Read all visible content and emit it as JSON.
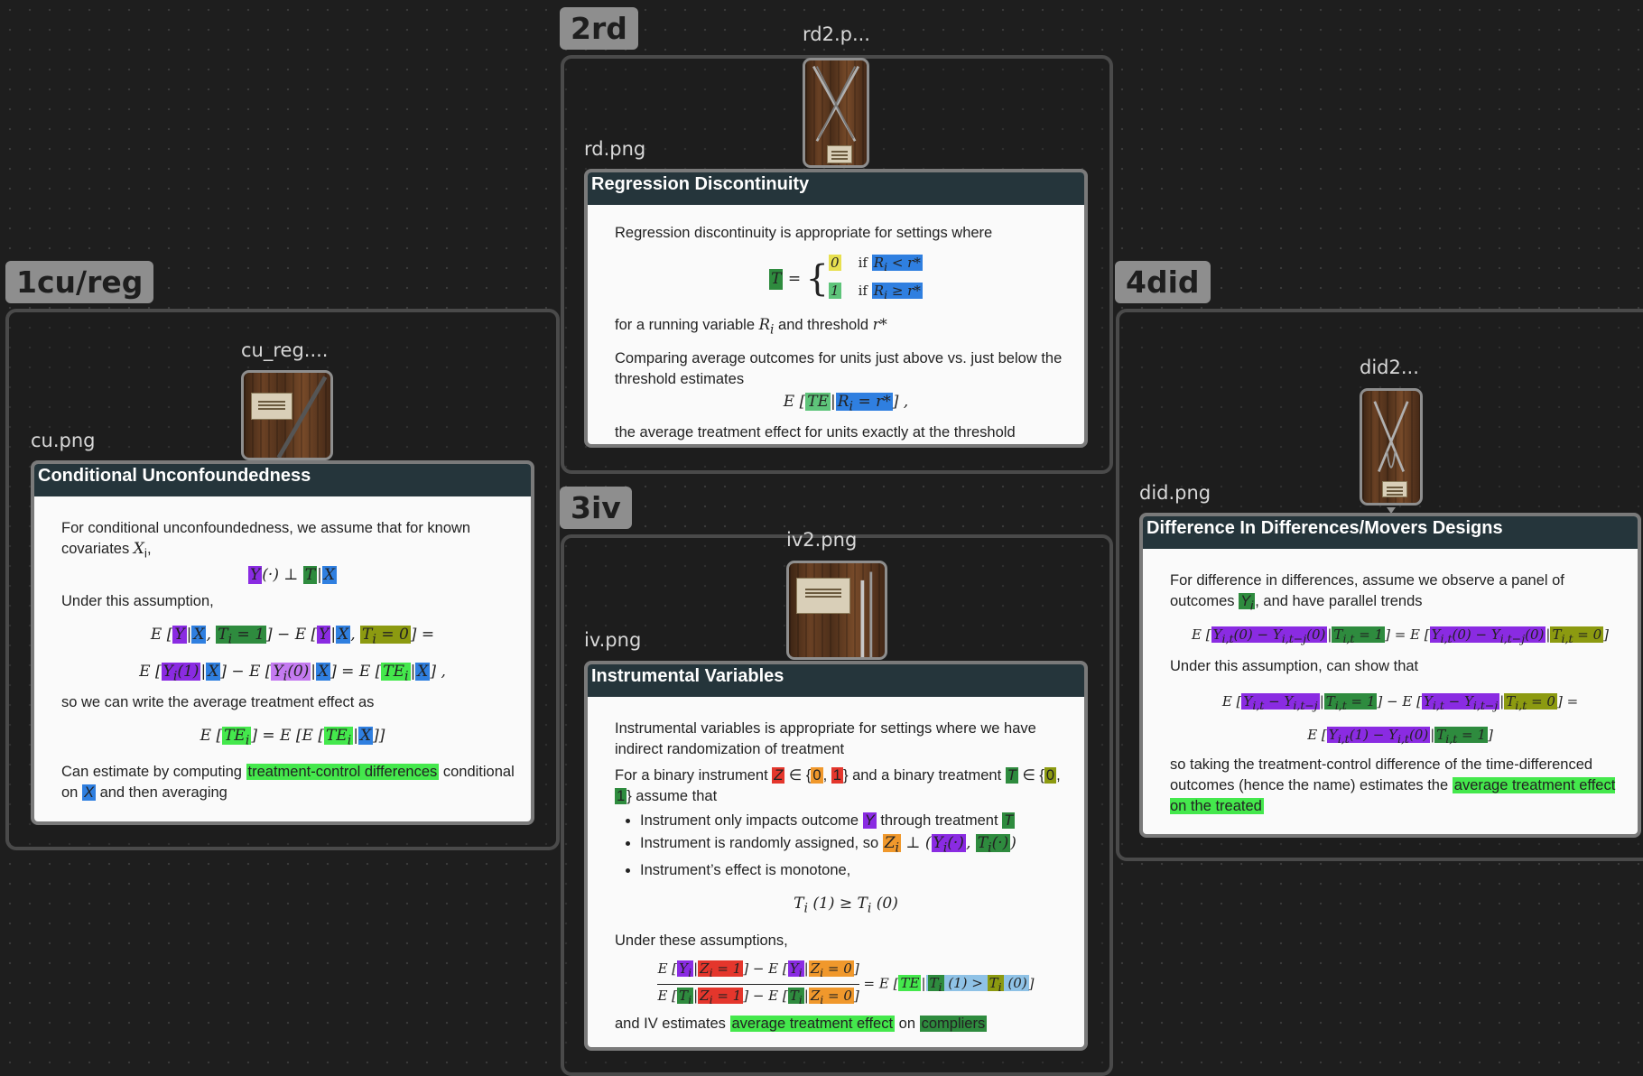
{
  "groups": {
    "cu": {
      "label": "1cu/reg"
    },
    "rd": {
      "label": "2rd"
    },
    "iv": {
      "label": "3iv"
    },
    "did": {
      "label": "4did"
    }
  },
  "files": {
    "cu_thumb": "cu_reg....",
    "cu_card": "cu.png",
    "rd_thumb": "rd2.p...",
    "rd_card": "rd.png",
    "iv_thumb": "iv2.png",
    "iv_card": "iv.png",
    "did_thumb": "did2...",
    "did_card": "did.png"
  },
  "cards": {
    "cu": {
      "title": "Conditional Unconfoundedness",
      "p1": "For conditional unconfoundedness, we assume that for known covariates",
      "p1_var": "X",
      "p1_sub": "i",
      "p1_end": ",",
      "p2": "Under this assumption,",
      "p3": "so we can write the average treatment effect as",
      "p4_pre": "Can estimate by computing",
      "p4_hl": "treatment-control differences",
      "p4_mid": "conditional on",
      "p4_end": "and then averaging"
    },
    "rd": {
      "title": "Regression Discontinuity",
      "p1": "Regression discontinuity is appropriate for settings where",
      "p2_pre": "for a running variable",
      "p2_mid": "and threshold",
      "p3": "Comparing average outcomes for units just above vs. just below the threshold estimates",
      "p4": "the average treatment effect for units exactly at the threshold"
    },
    "iv": {
      "title": "Instrumental Variables",
      "p1": "Instrumental variables is appropriate for settings where we have indirect randomization of treatment",
      "p2_pre": "For a binary instrument",
      "p2_mid": "and a binary treatment",
      "p2_end": "assume that",
      "b1_pre": "Instrument only impacts outcome",
      "b1_mid": "through treatment",
      "b2": "Instrument is randomly assigned, so",
      "b3": "Instrument’s effect is monotone,",
      "p3": "Under these assumptions,",
      "p4_pre": "and IV estimates",
      "p4_hl1": "average treatment effect",
      "p4_mid": "on",
      "p4_hl2": "compliers"
    },
    "did": {
      "title": "Difference In Differences/Movers Designs",
      "p1_pre": "For difference in differences, assume we observe a panel of outcomes",
      "p1_end": ", and have parallel trends",
      "p2": "Under this assumption, can show that",
      "p3": "so taking the treatment-control difference of the time-differenced outcomes (hence the name) estimates the",
      "p3_hl": "average treatment effect on the treated"
    }
  }
}
